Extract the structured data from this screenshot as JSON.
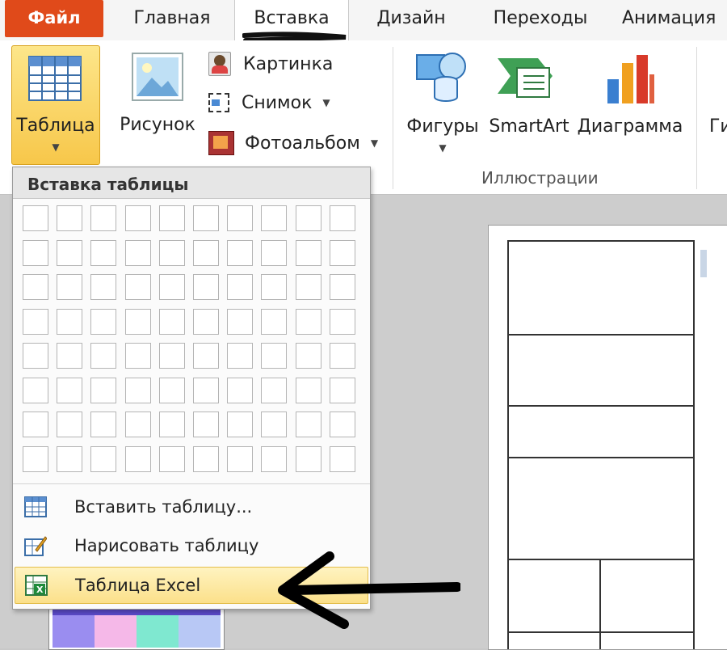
{
  "tabs": {
    "file": "Файл",
    "home": "Главная",
    "insert": "Вставка",
    "design": "Дизайн",
    "transitions": "Переходы",
    "animation": "Анимация"
  },
  "ribbon": {
    "table_button": "Таблица",
    "picture_button": "Рисунок",
    "clipart_button": "Картинка",
    "screenshot_button": "Снимок",
    "photoalbum_button": "Фотоальбом",
    "shapes_button": "Фигуры",
    "smartart_button": "SmartArt",
    "chart_button": "Диаграмма",
    "hyperlink_partial": "Ги",
    "illustrations_group": "Иллюстрации"
  },
  "dropdown": {
    "header": "Вставка таблицы",
    "grid_columns": 10,
    "grid_rows": 8,
    "items": [
      {
        "label": "Вставить таблицу...",
        "icon": "insert-table-icon",
        "highlighted": false
      },
      {
        "label": "Нарисовать таблицу",
        "icon": "draw-table-icon",
        "highlighted": false
      },
      {
        "label": "Таблица Excel",
        "icon": "excel-table-icon",
        "highlighted": true
      }
    ]
  },
  "colors": {
    "file_tab": "#e04a1a",
    "table_button_bg": "#f7c74a",
    "highlight": "#fbe08a"
  }
}
